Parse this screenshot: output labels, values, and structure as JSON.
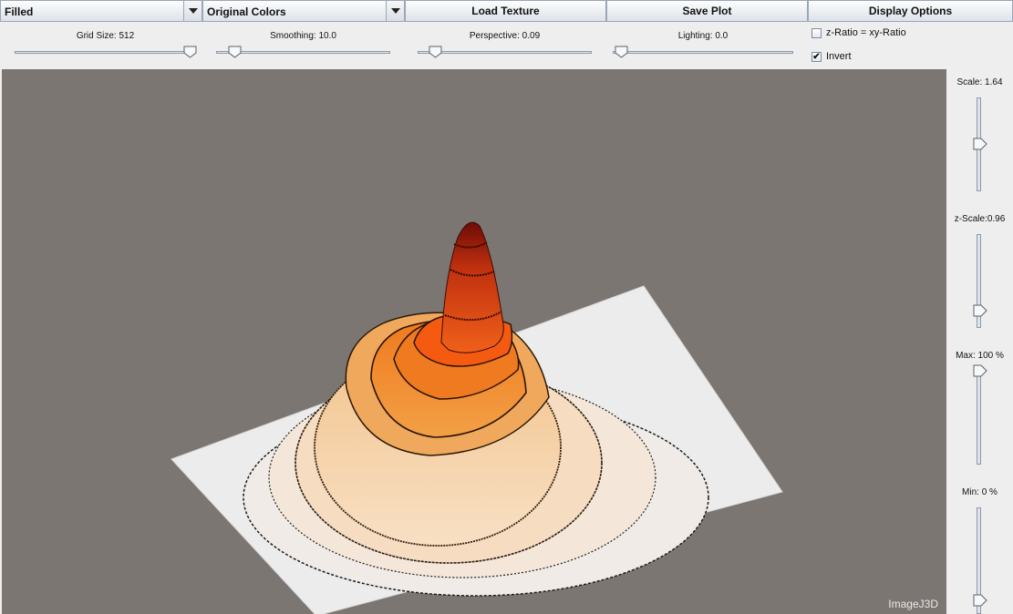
{
  "toolbar": {
    "render_mode": "Filled",
    "color_mode": "Original Colors",
    "load_texture": "Load Texture",
    "save_plot": "Save Plot",
    "display_options": "Display Options"
  },
  "sliders": {
    "grid_size": {
      "label": "Grid Size: 512",
      "level": 0.98
    },
    "smoothing": {
      "label": "Smoothing: 10.0",
      "level": 0.1
    },
    "perspective": {
      "label": "Perspective: 0.09",
      "level": 0.09
    },
    "lighting": {
      "label": "Lighting: 0.0",
      "level": 0.0
    }
  },
  "checkboxes": {
    "z_ratio": {
      "label": "z-Ratio = xy-Ratio",
      "checked": false
    },
    "invert": {
      "label": "Invert",
      "checked": true,
      "mark": "✔"
    }
  },
  "side_sliders": {
    "scale": {
      "label": "Scale: 1.64",
      "level": 0.5
    },
    "z_scale": {
      "label": "z-Scale:0.96",
      "level": 0.16
    },
    "max": {
      "label": "Max: 100 %",
      "level": 1.0
    },
    "min": {
      "label": "Min: 0 %",
      "level": 0.0
    }
  },
  "plot": {
    "watermark": "ImageJ3D",
    "background_color": "#7c7673"
  }
}
